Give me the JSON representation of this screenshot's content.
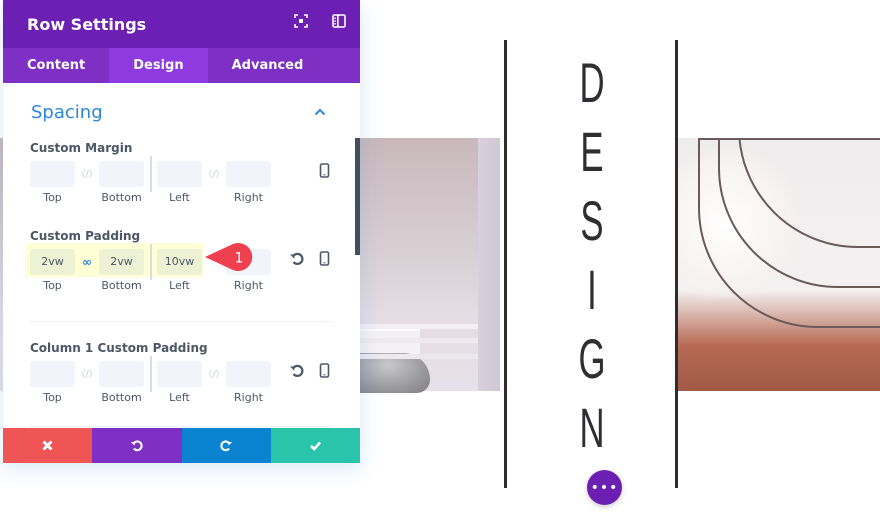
{
  "panel": {
    "title": "Row Settings",
    "header_icons": [
      "expand-icon",
      "sidebar-toggle-icon"
    ],
    "tabs": [
      {
        "label": "Content",
        "active": false
      },
      {
        "label": "Design",
        "active": true
      },
      {
        "label": "Advanced",
        "active": false
      }
    ],
    "section": {
      "title": "Spacing",
      "expanded": true
    },
    "groups": {
      "margin": {
        "label": "Custom Margin",
        "top": "",
        "bottom": "",
        "left": "",
        "right": "",
        "sub_labels": [
          "Top",
          "Bottom",
          "Left",
          "Right"
        ],
        "linked": false
      },
      "padding": {
        "label": "Custom Padding",
        "top": "2vw",
        "bottom": "2vw",
        "left": "10vw",
        "right": "",
        "sub_labels": [
          "Top",
          "Bottom",
          "Left",
          "Right"
        ],
        "linked": true
      },
      "column1_padding": {
        "label": "Column 1 Custom Padding",
        "top": "",
        "bottom": "",
        "left": "",
        "right": "",
        "sub_labels": [
          "Top",
          "Bottom",
          "Left",
          "Right"
        ],
        "linked": false
      }
    },
    "annotation_badge": "1",
    "footer": {
      "cancel_icon": "close-icon",
      "undo_icon": "undo-icon",
      "redo_icon": "redo-icon",
      "save_icon": "check-icon"
    }
  },
  "canvas": {
    "vertical_text": [
      "D",
      "E",
      "S",
      "I",
      "G",
      "N"
    ],
    "more_button": "•••"
  },
  "colors": {
    "header_purple": "#6c1fb3",
    "tab_purple": "#7e30c5",
    "active_tab": "#8e3ae0",
    "accent_blue": "#2b87da",
    "cancel_red": "#ef5555",
    "redo_blue": "#0c83d1",
    "save_green": "#29c4a9",
    "badge_red": "#ef4050"
  }
}
